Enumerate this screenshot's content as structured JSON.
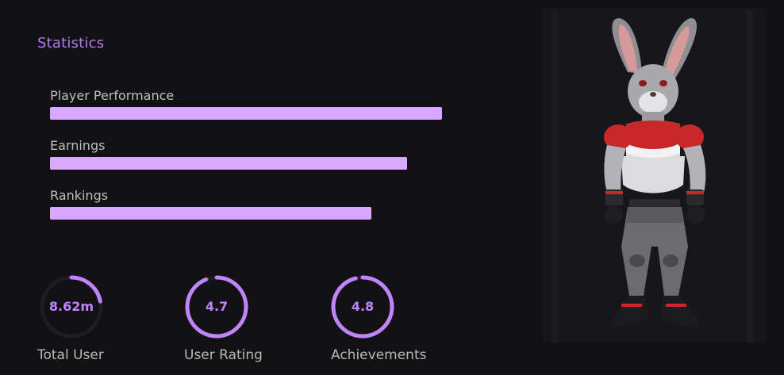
{
  "section_title": "Statistics",
  "stats": [
    {
      "label": "Player Performance",
      "fill_percent": 100
    },
    {
      "label": "Earnings",
      "fill_percent": 91
    },
    {
      "label": "Rankings",
      "fill_percent": 82
    }
  ],
  "rings": [
    {
      "value": "8.62m",
      "label": "Total User",
      "progress": 0.22
    },
    {
      "value": "4.7",
      "label": "User Rating",
      "progress": 0.94
    },
    {
      "value": "4.8",
      "label": "Achievements",
      "progress": 0.96
    }
  ],
  "colors": {
    "accent": "#c084fc",
    "bar": "#d8a7ff",
    "ring_track": "#1e1d21",
    "background": "#121113"
  },
  "hero_image": {
    "icon": "rabbit-athlete-character"
  }
}
